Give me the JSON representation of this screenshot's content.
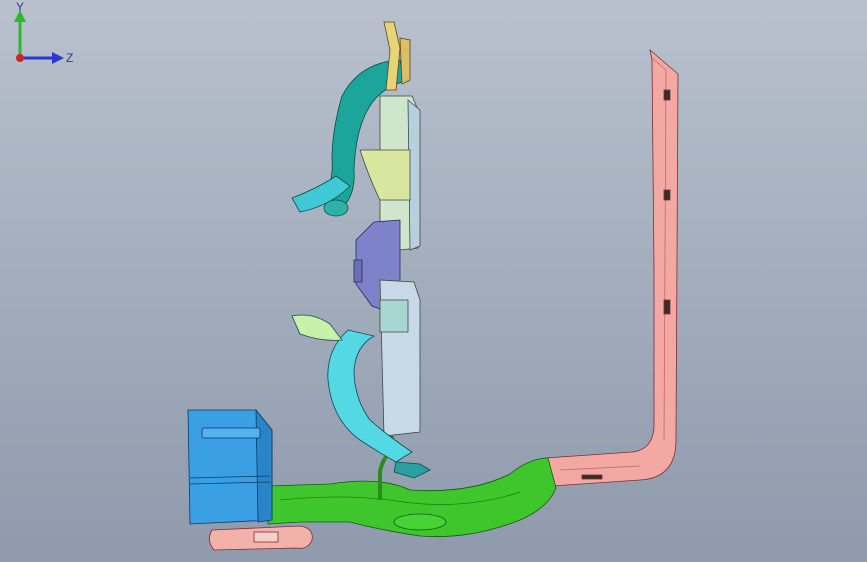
{
  "viewport": {
    "background_top": "#b9c1cd",
    "background_bottom": "#8f9aac"
  },
  "model": {
    "parts": [
      {
        "name": "blower-box",
        "color": "#3d9ee0"
      },
      {
        "name": "main-duct-green",
        "color": "#3bc02a"
      },
      {
        "name": "vertical-pipe-pink",
        "color": "#f0a3a0"
      },
      {
        "name": "upper-duct-teal",
        "color": "#1aa39a"
      },
      {
        "name": "lower-duct-cyan",
        "color": "#4fd7e0"
      },
      {
        "name": "center-bracket-purple",
        "color": "#7c7fc9"
      },
      {
        "name": "vent-panel-light",
        "color": "#c9e4cf"
      },
      {
        "name": "upper-branch-yellow",
        "color": "#e8d27a"
      },
      {
        "name": "bottom-pipe-pink",
        "color": "#f2b0a8"
      }
    ]
  },
  "triad": {
    "y_label": "Y",
    "z_label": "Z",
    "y_color": "#2fb52f",
    "z_color": "#2a3ad0",
    "x_color": "#d02020"
  }
}
